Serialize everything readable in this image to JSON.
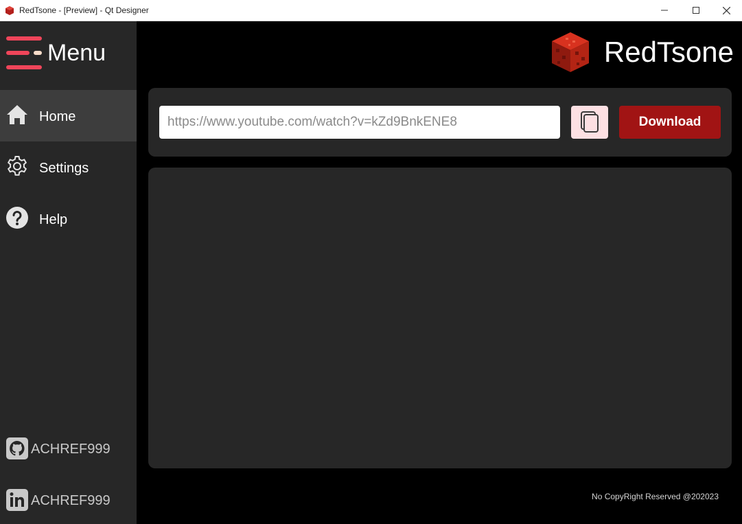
{
  "window": {
    "title": "RedTsone - [Preview] - Qt Designer",
    "controls": [
      "minimize-icon",
      "maximize-icon",
      "close-icon"
    ]
  },
  "sidebar": {
    "menu_label": "Menu",
    "items": [
      {
        "label": "Home",
        "icon": "home-icon",
        "active": true
      },
      {
        "label": "Settings",
        "icon": "gear-icon",
        "active": false
      },
      {
        "label": "Help",
        "icon": "help-icon",
        "active": false
      }
    ],
    "social": [
      {
        "label": "ACHREF999",
        "icon": "github-icon"
      },
      {
        "label": "ACHREF999",
        "icon": "linkedin-icon"
      }
    ]
  },
  "brand": {
    "name": "RedTsone",
    "logo": "redstone-cube-logo"
  },
  "search": {
    "placeholder": "https://www.youtube.com/watch?v=kZd9BnkENE8",
    "value": "",
    "paste_icon": "copy-icon",
    "download_label": "Download"
  },
  "footer": {
    "text": "No CopyRight Reserved @202023"
  },
  "colors": {
    "background": "#000000",
    "panel": "#272727",
    "sidebar": "#272727",
    "active_item": "#3d3d3d",
    "accent": "#a11414",
    "menu_accent": "#f0455a",
    "paste_button": "#fde0e3"
  }
}
